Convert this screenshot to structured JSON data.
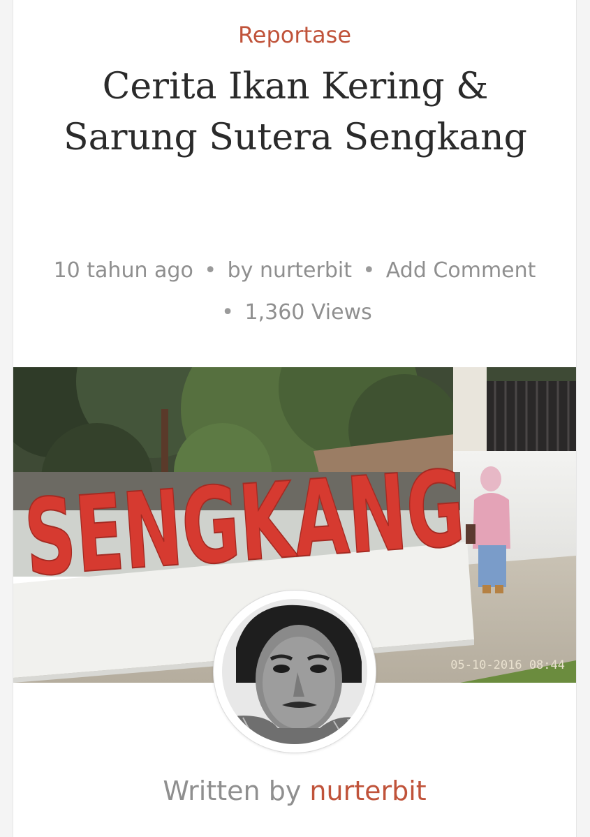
{
  "post": {
    "category": "Reportase",
    "title": "Cerita Ikan Kering & Sarung Sutera Sengkang",
    "meta": {
      "time": "10 tahun ago",
      "author_prefix": "by",
      "author": "nurterbit",
      "comment_link": "Add Comment",
      "views": "1,360 Views",
      "separator": "•"
    },
    "hero": {
      "sign_text": "SENGKANG",
      "timestamp": "05-10-2016 08:44"
    },
    "author_box": {
      "prefix": "Written by",
      "author": "nurterbit"
    }
  },
  "colors": {
    "accent": "#c0533a",
    "title": "#2a2a2a",
    "meta": "#8f8f8f",
    "sign_red": "#d63a30"
  }
}
